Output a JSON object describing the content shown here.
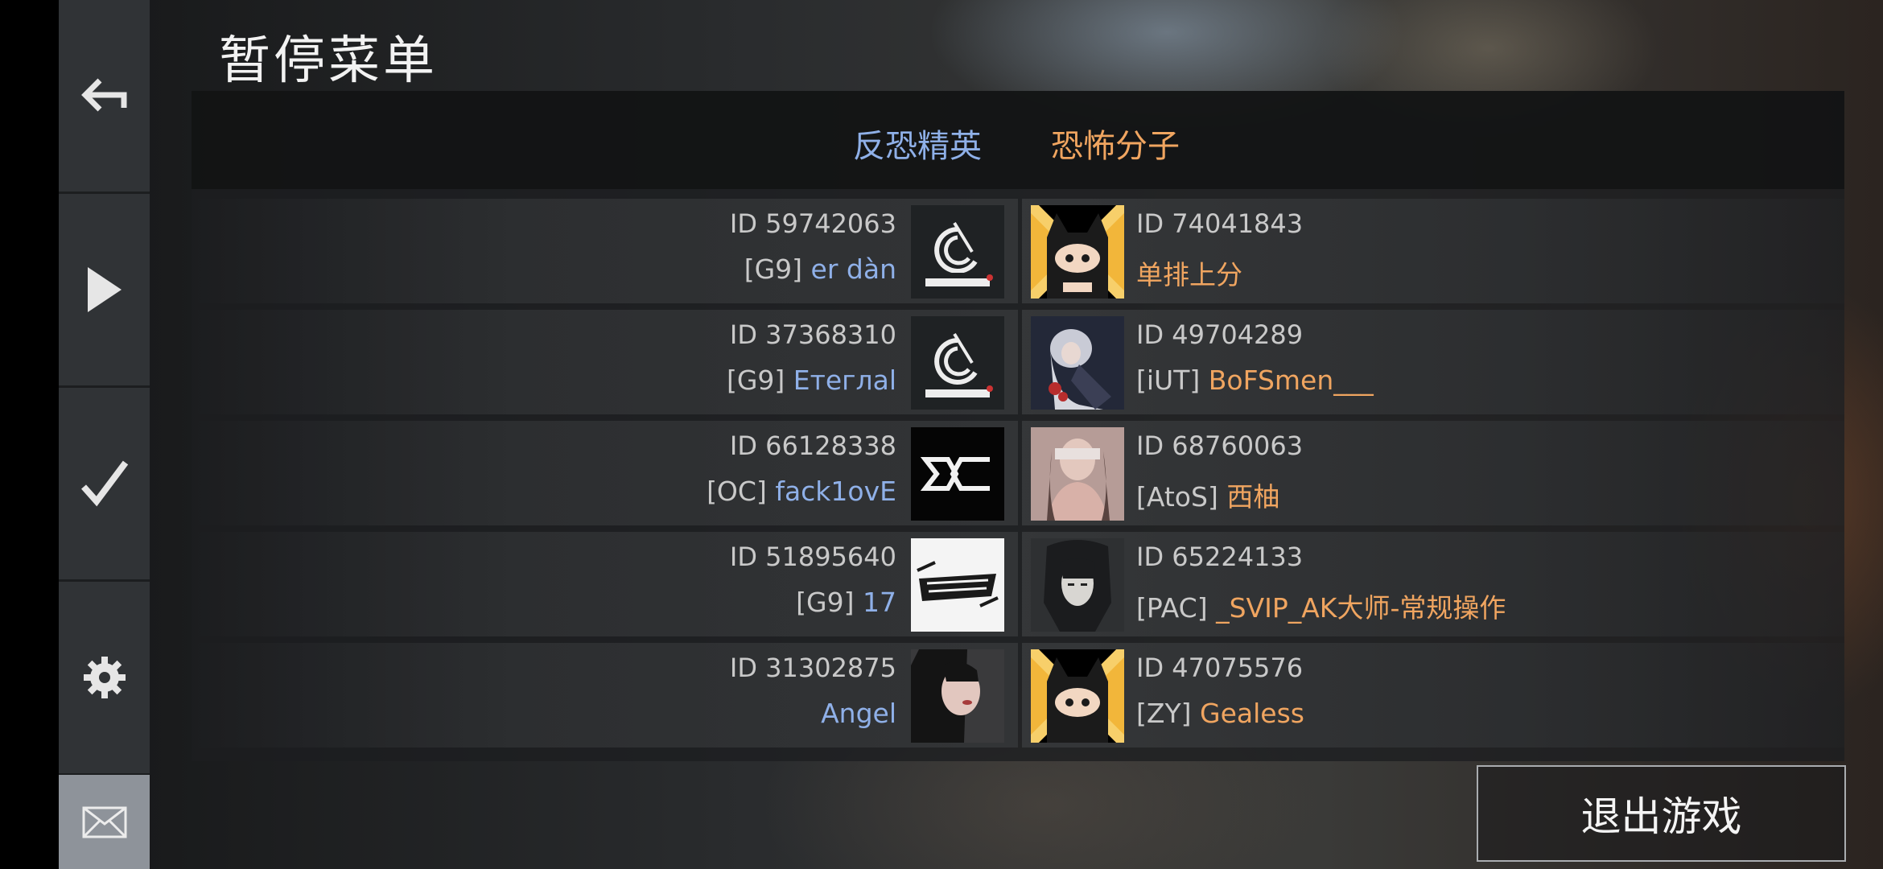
{
  "title": "暂停菜单",
  "sidebar": {
    "back_icon": "back-arrow-icon",
    "play_icon": "play-icon",
    "check_icon": "checkmark-icon",
    "settings_icon": "gear-icon",
    "mail_icon": "mail-icon"
  },
  "tabs": [
    {
      "label": "反恐精英",
      "color": "#8fb0e8"
    },
    {
      "label": "恐怖分子",
      "color": "#f0a560"
    }
  ],
  "ct_players": [
    {
      "id": "ID 59742063",
      "tag": "[G9]",
      "name": "er dàn",
      "avatar": "guard9-logo"
    },
    {
      "id": "ID 37368310",
      "tag": "[G9]",
      "name": "Етеглаl",
      "avatar": "guard9-logo"
    },
    {
      "id": "ID 66128338",
      "tag": "[OC]",
      "name": "fack1ovE",
      "avatar": "oc-logo"
    },
    {
      "id": "ID 51895640",
      "tag": "[G9]",
      "name": "17",
      "avatar": "guard9-text-logo"
    },
    {
      "id": "ID 31302875",
      "tag": "",
      "name": "Angel",
      "avatar": "girl-photo"
    }
  ],
  "t_players": [
    {
      "id": "ID 74041843",
      "tag": "",
      "name": "单排上分",
      "avatar": "ninja-cat"
    },
    {
      "id": "ID 49704289",
      "tag": "[iUT]",
      "name": "BoFSmen___",
      "avatar": "anime-girl"
    },
    {
      "id": "ID 68760063",
      "tag": "[AtoS]",
      "name": "西柚",
      "avatar": "woman-photo"
    },
    {
      "id": "ID 65224133",
      "tag": "[PAC]",
      "name": "_SVIP_AK大师-常规操作",
      "avatar": "anime-man"
    },
    {
      "id": "ID 47075576",
      "tag": "[ZY]",
      "name": "Gealess",
      "avatar": "ninja-cat"
    }
  ],
  "exit_button": "退出游戏",
  "colors": {
    "ct": "#8fb0e8",
    "t": "#f0a560"
  }
}
